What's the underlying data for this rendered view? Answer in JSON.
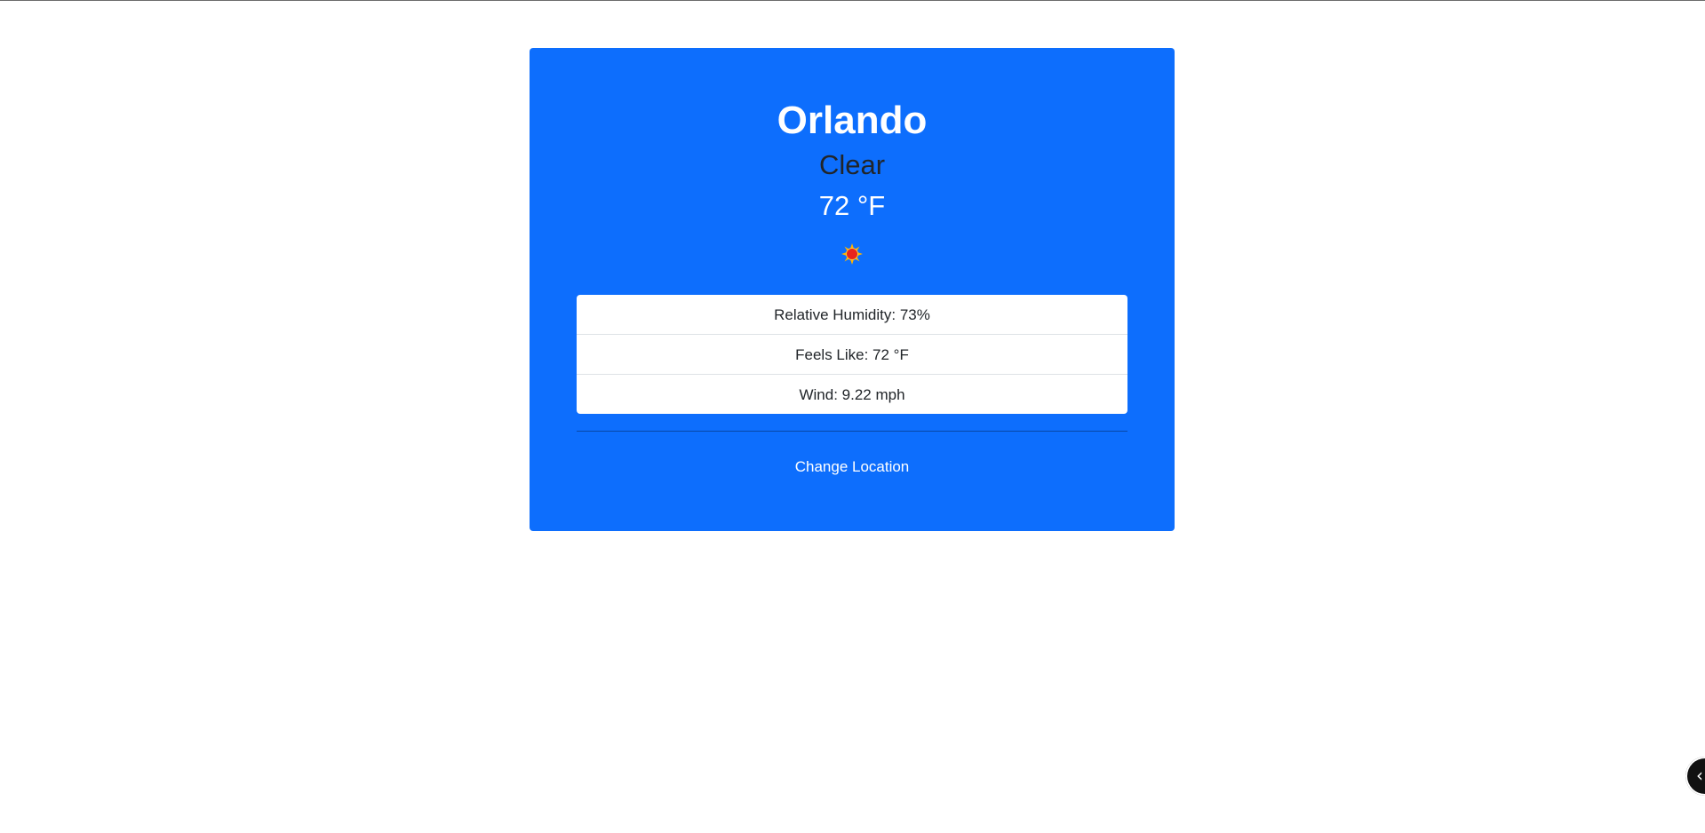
{
  "weather": {
    "city": "Orlando",
    "condition": "Clear",
    "temperature": "72 °F",
    "icon": "sun-icon",
    "details": [
      {
        "label": "Relative Humidity: 73%"
      },
      {
        "label": "Feels Like: 72 °F"
      },
      {
        "label": "Wind: 9.22 mph"
      }
    ],
    "change_location_label": "Change Location"
  },
  "colors": {
    "card_background": "#0d6efd",
    "condition_text": "#212529",
    "page_background": "#ffffff"
  },
  "corner_widget": {
    "icon": "chevron-left-icon",
    "glyph": "‹"
  }
}
